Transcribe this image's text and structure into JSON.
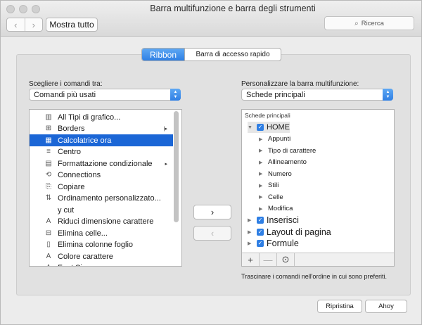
{
  "window": {
    "title": "Barra multifunzione e barra degli strumenti",
    "back_glyph": "‹",
    "forward_glyph": "›",
    "show_all": "Mostra tutto",
    "search_placeholder": "Ricerca"
  },
  "tabs": {
    "ribbon": "Ribbon",
    "quick_access": "Barra di accesso rapido"
  },
  "left": {
    "label": "Scegliere i comandi tra:",
    "selected": "Comandi più usati",
    "items": [
      {
        "label": "All  Tipi di grafico...",
        "icon": "chart-icon",
        "glyph": "▥"
      },
      {
        "label": "Borders",
        "icon": "borders-icon",
        "glyph": "⊞",
        "submenu": "|▸"
      },
      {
        "label": "Calcolatrice ora",
        "icon": "calculator-icon",
        "glyph": "▦"
      },
      {
        "label": "Centro",
        "icon": "align-center-icon",
        "glyph": "≡"
      },
      {
        "label": "Formattazione condizionale",
        "icon": "conditional-format-icon",
        "glyph": "▤",
        "submenu": "▸"
      },
      {
        "label": "Connections",
        "icon": "connections-icon",
        "glyph": "⟲"
      },
      {
        "label": "Copiare",
        "icon": "copy-icon",
        "glyph": "⎘"
      },
      {
        "label": "Ordinamento personalizzato...",
        "icon": "sort-icon",
        "glyph": "⇅"
      },
      {
        "label": "y cut",
        "icon": "",
        "glyph": ""
      },
      {
        "label": "Riduci dimensione carattere",
        "icon": "decrease-font-icon",
        "glyph": "A"
      },
      {
        "label": "Elimina celle...",
        "icon": "delete-cells-icon",
        "glyph": "⊟"
      },
      {
        "label": "Elimina colonne foglio",
        "icon": "delete-columns-icon",
        "glyph": "▯"
      },
      {
        "label": "Colore carattere",
        "icon": "font-color-icon",
        "glyph": "A"
      },
      {
        "label": "Font Size",
        "icon": "font-size-icon",
        "glyph": "A"
      }
    ]
  },
  "right": {
    "label": "Personalizzare la barra multifunzione:",
    "selected": "Schede principali",
    "header": "Schede principali",
    "tree": [
      {
        "label": "HOME",
        "checked": true,
        "expanded": true,
        "level": 0
      },
      {
        "label": "Appunti",
        "level": 1
      },
      {
        "label": "Tipo di carattere",
        "level": 1
      },
      {
        "label": "Allineamento",
        "level": 1
      },
      {
        "label": "Numero",
        "level": 1
      },
      {
        "label": "Stili",
        "level": 1
      },
      {
        "label": "Celle",
        "level": 1
      },
      {
        "label": "Modifica",
        "level": 1
      },
      {
        "label": "Inserisci",
        "checked": true,
        "level": 0
      },
      {
        "label": "Layout di pagina",
        "checked": true,
        "level": 0
      },
      {
        "label": "Formule",
        "checked": true,
        "level": 0
      }
    ],
    "add_glyph": "+",
    "remove_glyph": "—",
    "more_glyph": "⊙"
  },
  "add_arrow": "›",
  "remove_arrow": "‹",
  "hint": "Trascinare i comandi nell'ordine in cui sono preferiti.",
  "buttons": {
    "reset": "Ripristina",
    "ok": "Ahoy"
  }
}
